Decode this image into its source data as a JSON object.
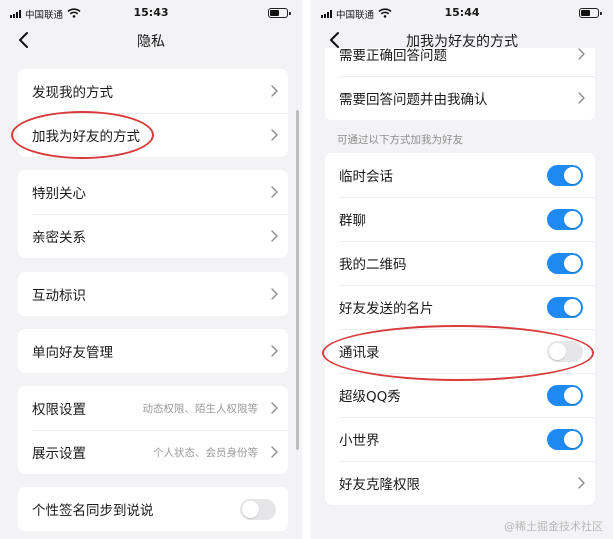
{
  "left": {
    "status": {
      "carrier": "中国联通",
      "time": "15:43"
    },
    "title": "隐私",
    "groups": [
      {
        "items": [
          {
            "label": "发现我的方式",
            "sub": ""
          },
          {
            "label": "加我为好友的方式",
            "sub": ""
          }
        ]
      },
      {
        "items": [
          {
            "label": "特别关心",
            "sub": ""
          },
          {
            "label": "亲密关系",
            "sub": ""
          }
        ]
      },
      {
        "items": [
          {
            "label": "互动标识",
            "sub": ""
          }
        ]
      },
      {
        "items": [
          {
            "label": "单向好友管理",
            "sub": ""
          }
        ]
      },
      {
        "items": [
          {
            "label": "权限设置",
            "sub": "动态权限、陌生人权限等"
          },
          {
            "label": "展示设置",
            "sub": "个人状态、会员身份等"
          }
        ]
      },
      {
        "items": [
          {
            "label": "个性签名同步到说说",
            "toggle": false
          }
        ]
      }
    ]
  },
  "right": {
    "status": {
      "carrier": "中国联通",
      "time": "15:44"
    },
    "title": "加我为好友的方式",
    "top_rows": [
      {
        "label": "需要正确回答问题"
      },
      {
        "label": "需要回答问题并由我确认"
      }
    ],
    "section_label": "可通过以下方式加我为好友",
    "methods": [
      {
        "label": "临时会话",
        "enabled": true
      },
      {
        "label": "群聊",
        "enabled": true
      },
      {
        "label": "我的二维码",
        "enabled": true
      },
      {
        "label": "好友发送的名片",
        "enabled": true
      },
      {
        "label": "通讯录",
        "enabled": false
      },
      {
        "label": "超级QQ秀",
        "enabled": true
      },
      {
        "label": "小世界",
        "enabled": true
      }
    ],
    "bottom_row": {
      "label": "好友克隆权限"
    }
  },
  "watermark": "@稀土掘金技术社区",
  "colors": {
    "accent": "#1f8bf2",
    "annotation": "#d93a3a",
    "background": "#f3f3f5"
  },
  "icons": {
    "back": "chevron-left-icon",
    "row": "chevron-right-icon",
    "wifi": "wifi-icon",
    "battery": "battery-icon",
    "signal": "signal-icon"
  }
}
